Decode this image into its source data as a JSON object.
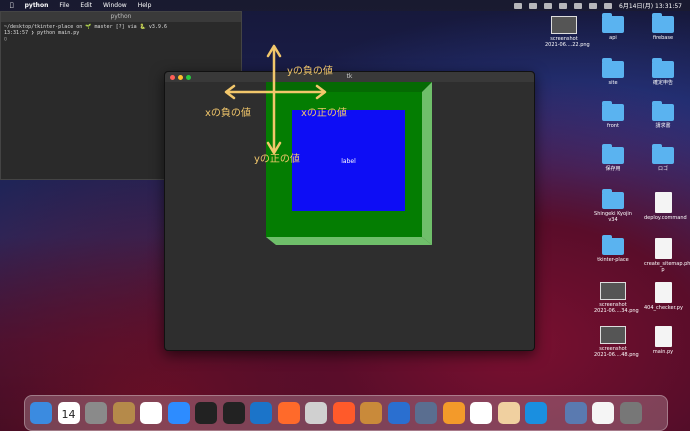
{
  "menubar": {
    "apple": "",
    "app": "python",
    "items": [
      "File",
      "Edit",
      "Window",
      "Help"
    ],
    "clock": "6月14日(月)  13:31:57"
  },
  "terminal": {
    "title": "python",
    "lines": [
      "~/desktop/tkinter-place on 🌱 master [?] via 🐍 v3.9.6",
      "13:31:57 ❯ python main.py",
      "▯"
    ]
  },
  "tk_window": {
    "title": "tk",
    "label": "label"
  },
  "annotations": {
    "y_neg": "yの負の値",
    "x_neg": "xの負の値",
    "x_pos": "xの正の値",
    "y_pos": "yの正の値"
  },
  "desktop": {
    "icons": [
      {
        "label": "screenshot\n2021-06....22.png",
        "type": "shot"
      },
      {
        "label": "api",
        "type": "folder"
      },
      {
        "label": "firebase",
        "type": "folder"
      },
      {
        "label": "site",
        "type": "folder"
      },
      {
        "label": "確定申告",
        "type": "folder"
      },
      {
        "label": "front",
        "type": "folder"
      },
      {
        "label": "請求書",
        "type": "folder"
      },
      {
        "label": "保存用",
        "type": "folder"
      },
      {
        "label": "ロゴ",
        "type": "folder"
      },
      {
        "label": "Shingeki Kyojin\nv34",
        "type": "folder"
      },
      {
        "label": "deploy.command",
        "type": "doc"
      },
      {
        "label": "tkinter-place",
        "type": "folder"
      },
      {
        "label": "create_sitemap.ph\np",
        "type": "doc"
      },
      {
        "label": "screenshot\n2021-06....34.png",
        "type": "shot"
      },
      {
        "label": "404_checker.py",
        "type": "doc"
      },
      {
        "label": "screenshot\n2021-06....48.png",
        "type": "shot"
      },
      {
        "label": "main.py",
        "type": "doc"
      }
    ]
  },
  "dock": {
    "calendar_day": "14",
    "calendar_month": "JUL",
    "apps": [
      "finder-icon",
      "calendar-icon",
      "system-preferences-icon",
      "archive-icon",
      "chrome-icon",
      "zoom-icon",
      "terminal-icon",
      "terminal2-icon",
      "vscode-icon",
      "safari-icon",
      "stack-icon",
      "monitor-icon",
      "app-icon",
      "docker-icon",
      "camera-icon",
      "drawio-icon",
      "postman-icon",
      "photos-icon",
      "infinity-icon",
      "preview-icon",
      "document-icon",
      "trash-icon"
    ],
    "colors": [
      "#3b8be0",
      "#ffffff",
      "#8a8a8a",
      "#b58a4a",
      "#ffffff",
      "#2d8cff",
      "#222222",
      "#222222",
      "#1b74c9",
      "#ff6a2a",
      "#d0d0d0",
      "#ff5a2a",
      "#c98a3a",
      "#2a6fd0",
      "#5a6e90",
      "#f39a2a",
      "#ffffff",
      "#f0d0a0",
      "#1a8fe0",
      "#5a7ab0",
      "#f5f5f5",
      "#777777"
    ]
  }
}
